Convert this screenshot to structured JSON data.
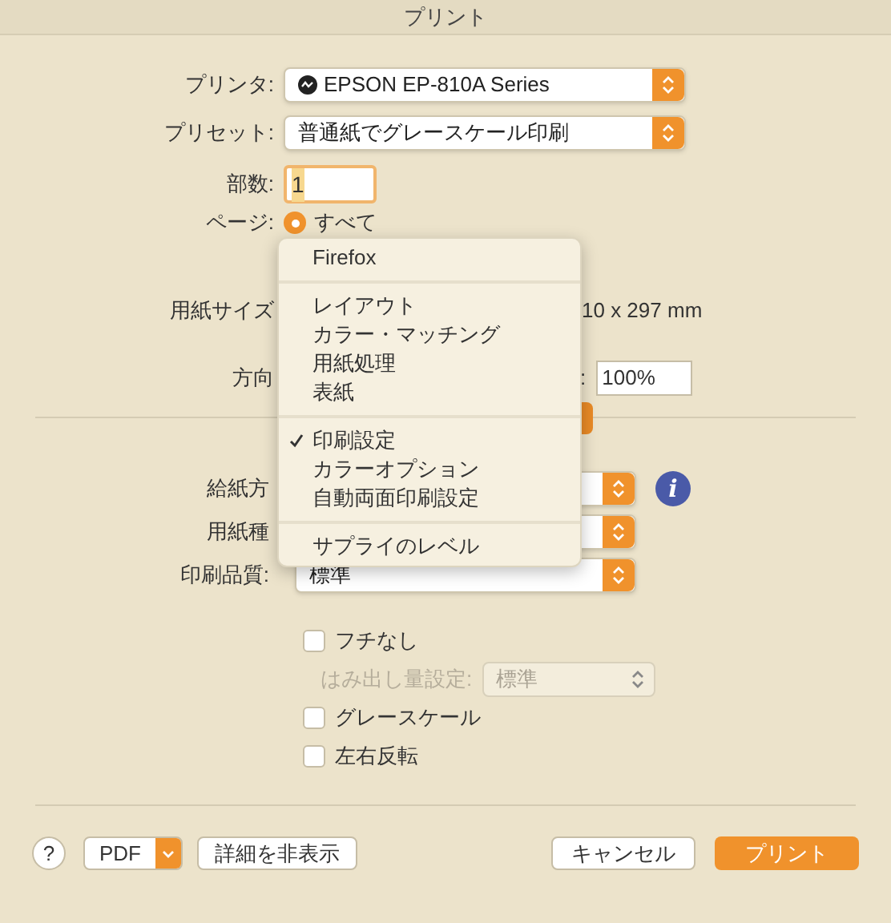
{
  "window": {
    "title": "プリント"
  },
  "printer": {
    "label": "プリンタ:",
    "value": "EPSON EP-810A Series"
  },
  "preset": {
    "label": "プリセット:",
    "value": "普通紙でグレースケール印刷"
  },
  "copies": {
    "label": "部数:",
    "value": "1",
    "focused": true
  },
  "pages": {
    "label": "ページ:",
    "option": "すべて",
    "selected": true
  },
  "paper_size": {
    "label": "用紙サイズ",
    "dimensions": "10 x 297 mm"
  },
  "orientation": {
    "label": "方向",
    "scale_label": ":",
    "scale": "100%"
  },
  "settings": [
    {
      "label": "給紙方",
      "info": "i"
    },
    {
      "label": "用紙種"
    },
    {
      "label": "印刷品質:",
      "value": "標準"
    }
  ],
  "options": [
    {
      "kind": "checkbox",
      "label": "フチなし",
      "checked": false
    },
    {
      "kind": "popup",
      "label": "はみ出し量設定:",
      "value": "標準",
      "disabled": true
    },
    {
      "kind": "checkbox",
      "label": "グレースケール",
      "checked": false
    },
    {
      "kind": "checkbox",
      "label": "左右反転",
      "checked": false
    }
  ],
  "menu": {
    "sections": [
      [
        {
          "label": "Firefox",
          "checked": false
        }
      ],
      [
        {
          "label": "レイアウト",
          "checked": false
        },
        {
          "label": "カラー・マッチング",
          "checked": false
        },
        {
          "label": "用紙処理",
          "checked": false
        },
        {
          "label": "表紙",
          "checked": false
        }
      ],
      [
        {
          "label": "印刷設定",
          "checked": true
        },
        {
          "label": "カラーオプション",
          "checked": false
        },
        {
          "label": "自動両面印刷設定",
          "checked": false
        }
      ],
      [
        {
          "label": "サプライのレベル",
          "checked": false
        }
      ]
    ]
  },
  "footer": {
    "help": "?",
    "pdf": "PDF",
    "details": "詳細を非表示",
    "cancel": "キャンセル",
    "print": "プリント"
  }
}
